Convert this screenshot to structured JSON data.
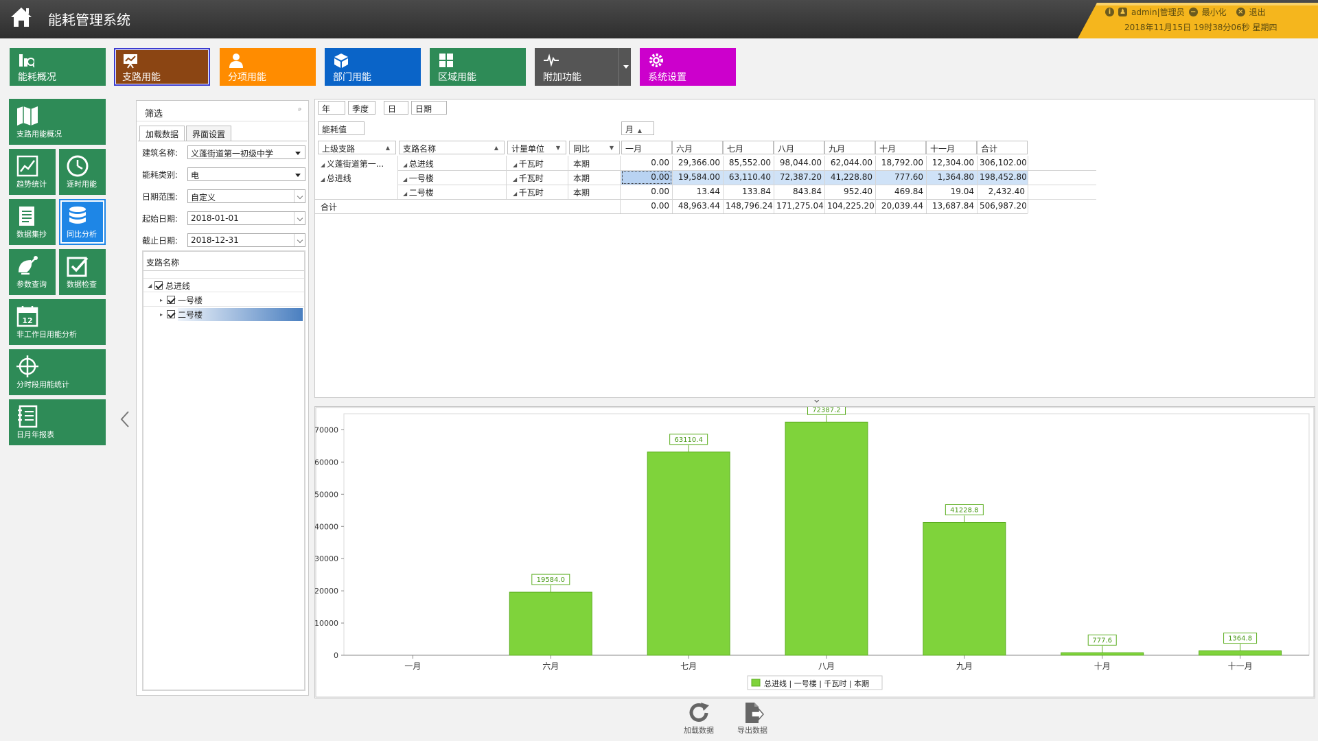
{
  "app": {
    "title": "能耗管理系统",
    "user": "admin|管理员",
    "minimize": "最小化",
    "logout": "退出",
    "datetime": "2018年11月15日 19时38分06秒 星期四"
  },
  "colors": {
    "green": "#2e8b57",
    "brown": "#8b4513",
    "orange": "#ff8c00",
    "blue": "#0a64c8",
    "gray": "#555555",
    "magenta": "#cc00cc",
    "bar": "#7fd33b"
  },
  "nav": [
    {
      "label": "能耗概况",
      "icon": "bar-chart-icon",
      "color": "#2e8b57"
    },
    {
      "label": "支路用能",
      "icon": "presentation-icon",
      "color": "#8b4513"
    },
    {
      "label": "分项用能",
      "icon": "user-icon",
      "color": "#ff8c00"
    },
    {
      "label": "部门用能",
      "icon": "cube-icon",
      "color": "#0a64c8"
    },
    {
      "label": "区域用能",
      "icon": "grid-icon",
      "color": "#2e8b57"
    },
    {
      "label": "附加功能",
      "icon": "pulse-icon",
      "color": "#555555"
    },
    {
      "label": "系统设置",
      "icon": "gear-icon",
      "color": "#cc00cc"
    }
  ],
  "side": [
    {
      "label": "支路用能概况",
      "icon": "map-icon"
    },
    {
      "label": "趋势统计",
      "icon": "trend-chart-icon"
    },
    {
      "label": "逐时用能",
      "icon": "clock-icon"
    },
    {
      "label": "数据集抄",
      "icon": "document-icon"
    },
    {
      "label": "同比分析",
      "icon": "database-icon"
    },
    {
      "label": "参数查询",
      "icon": "satellite-icon"
    },
    {
      "label": "数据检查",
      "icon": "checkbox-icon"
    },
    {
      "label": "非工作日用能分析",
      "icon": "calendar-icon",
      "day": "12"
    },
    {
      "label": "分时段用能统计",
      "icon": "crosshair-icon"
    },
    {
      "label": "日月年报表",
      "icon": "notebook-icon"
    }
  ],
  "filter": {
    "title": "筛选",
    "pin": "ᵖ",
    "tabs": [
      "加载数据",
      "界面设置"
    ],
    "building_label": "建筑名称:",
    "building_value": "义蓬街道第一初级中学",
    "energy_label": "能耗类别:",
    "energy_value": "电",
    "range_label": "日期范围:",
    "range_value": "自定义",
    "start_label": "起始日期:",
    "start_value": "2018-01-01",
    "end_label": "截止日期:",
    "end_value": "2018-12-31",
    "tree_header": "支路名称",
    "tree": [
      {
        "label": "总进线"
      },
      {
        "label": "一号楼"
      },
      {
        "label": "二号楼"
      }
    ]
  },
  "grid": {
    "groupchips": [
      "年",
      "季度",
      "日",
      "日期"
    ],
    "datafield": "能耗值",
    "colfield": "月",
    "rowheaders": [
      "上级支路",
      "支路名称",
      "计量单位",
      "同比"
    ],
    "months": [
      "一月",
      "六月",
      "七月",
      "八月",
      "九月",
      "十月",
      "十一月",
      "合计"
    ],
    "parent1": "义蓬街道第一...",
    "parent2": "总进线",
    "rows": [
      {
        "branch": "总进线",
        "unit": "千瓦时",
        "period": "本期",
        "values": [
          "0.00",
          "29,366.00",
          "85,552.00",
          "98,044.00",
          "62,044.00",
          "18,792.00",
          "12,304.00",
          "306,102.00"
        ]
      },
      {
        "branch": "一号楼",
        "unit": "千瓦时",
        "period": "本期",
        "values": [
          "0.00",
          "19,584.00",
          "63,110.40",
          "72,387.20",
          "41,228.80",
          "777.60",
          "1,364.80",
          "198,452.80"
        ]
      },
      {
        "branch": "二号楼",
        "unit": "千瓦时",
        "period": "本期",
        "values": [
          "0.00",
          "13.44",
          "133.84",
          "843.84",
          "952.40",
          "469.84",
          "19.04",
          "2,432.40"
        ]
      }
    ],
    "total_label": "合计",
    "totals": [
      "0.00",
      "48,963.44",
      "148,796.24",
      "171,275.04",
      "104,225.20",
      "20,039.44",
      "13,687.84",
      "506,987.20"
    ]
  },
  "chart_data": {
    "type": "bar",
    "categories": [
      "一月",
      "六月",
      "七月",
      "八月",
      "九月",
      "十月",
      "十一月"
    ],
    "series": [
      {
        "name": "总进线 | 一号楼 | 千瓦时 | 本期",
        "values": [
          0,
          19584.0,
          63110.4,
          72387.2,
          41228.8,
          777.6,
          1364.8
        ]
      }
    ],
    "data_labels": [
      "",
      "19584.0",
      "63110.4",
      "72387.2",
      "41228.8",
      "777.6",
      "1364.8"
    ],
    "yticks": [
      0,
      10000,
      20000,
      30000,
      40000,
      50000,
      60000,
      70000
    ],
    "ylim": [
      0,
      75000
    ],
    "grid": false,
    "legend": "bottom"
  },
  "buttons": {
    "load": "加载数据",
    "export": "导出数据"
  }
}
